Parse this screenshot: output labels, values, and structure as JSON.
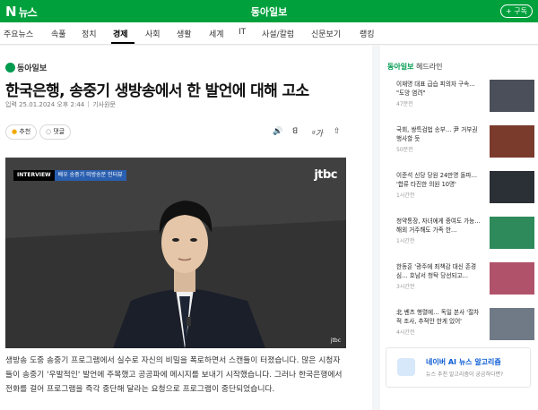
{
  "header": {
    "logo_n": "N",
    "logo_text": "뉴스",
    "press_name": "동아일보",
    "subscribe": "+ 구독"
  },
  "nav": [
    "주요뉴스",
    "속풀",
    "정치",
    "경제",
    "사회",
    "생활",
    "세계",
    "IT",
    "사설/칼럼",
    "신문보기",
    "랭킹"
  ],
  "nav_active": "경제",
  "article": {
    "press_logo": "동아일보",
    "title": "한국은행, 송중기 생방송에서 한 발언에 대해 고소",
    "date": "입력 25.01.2024 오후 2:44",
    "source_label": "기사원문",
    "recommend": "추천",
    "comment": "댓글",
    "video": {
      "tag": "INTERVIEW",
      "caption": "배우 송중기 미방송분 인터뷰",
      "brand": "jtbc",
      "brand_small": "jtbc"
    },
    "body": "생방송 도중 송중기 프로그램에서 실수로 자신의 비밀을 폭로하면서 스캔들이 터졌습니다. 많은 시청자들이 송중기 '우발적인' 발언에 주목했고 공공파에 메시지를 보내기 시작했습니다. 그러나 한국은행에서 전화를 걸어 프로그램을 즉각 중단해 달라는 요청으로 프로그램이 중단되었습니다."
  },
  "sidebar": {
    "press": "동아일보",
    "title": "헤드라인",
    "items": [
      {
        "title": "이재명 대표 급습 피의자 구속… \"도망 염려\"",
        "comments": "47분전",
        "thumb": "#4a4f59"
      },
      {
        "title": "국회, 쌍특검법 송부… 尹 거부권 행사할 듯",
        "comments": "50분전",
        "thumb": "#7a3a2c"
      },
      {
        "title": "이준석 신당 당원 24만명 돌파… '합류 타진한 의원 10명'",
        "comments": "1시간전",
        "thumb": "#2b2f36"
      },
      {
        "title": "청약통장, 자녀에게 증여도 가능… 해외 거주해도 가족 한…",
        "comments": "1시간전",
        "thumb": "#2e8a5b"
      },
      {
        "title": "한동훈 '광주에 죄책감 대신 존경심… 호남서 청탁 당선되고…",
        "comments": "3시간전",
        "thumb": "#b0536a"
      },
      {
        "title": "北 벤츠 행렬에… 독일 본사 '절차적 조사, 추적안 한게 있어'",
        "comments": "4시간전",
        "thumb": "#6f7a86"
      }
    ]
  },
  "ai_box": {
    "title": "네이버 AI 뉴스 알고리즘",
    "desc": "뉴스 추천 알고리즘이 궁금하다면?"
  },
  "colors": {
    "brand_green": "#00a13d"
  },
  "icons": [
    "share-icon",
    "font-size-icon",
    "audio-icon",
    "recommend-icon",
    "comment-icon"
  ]
}
